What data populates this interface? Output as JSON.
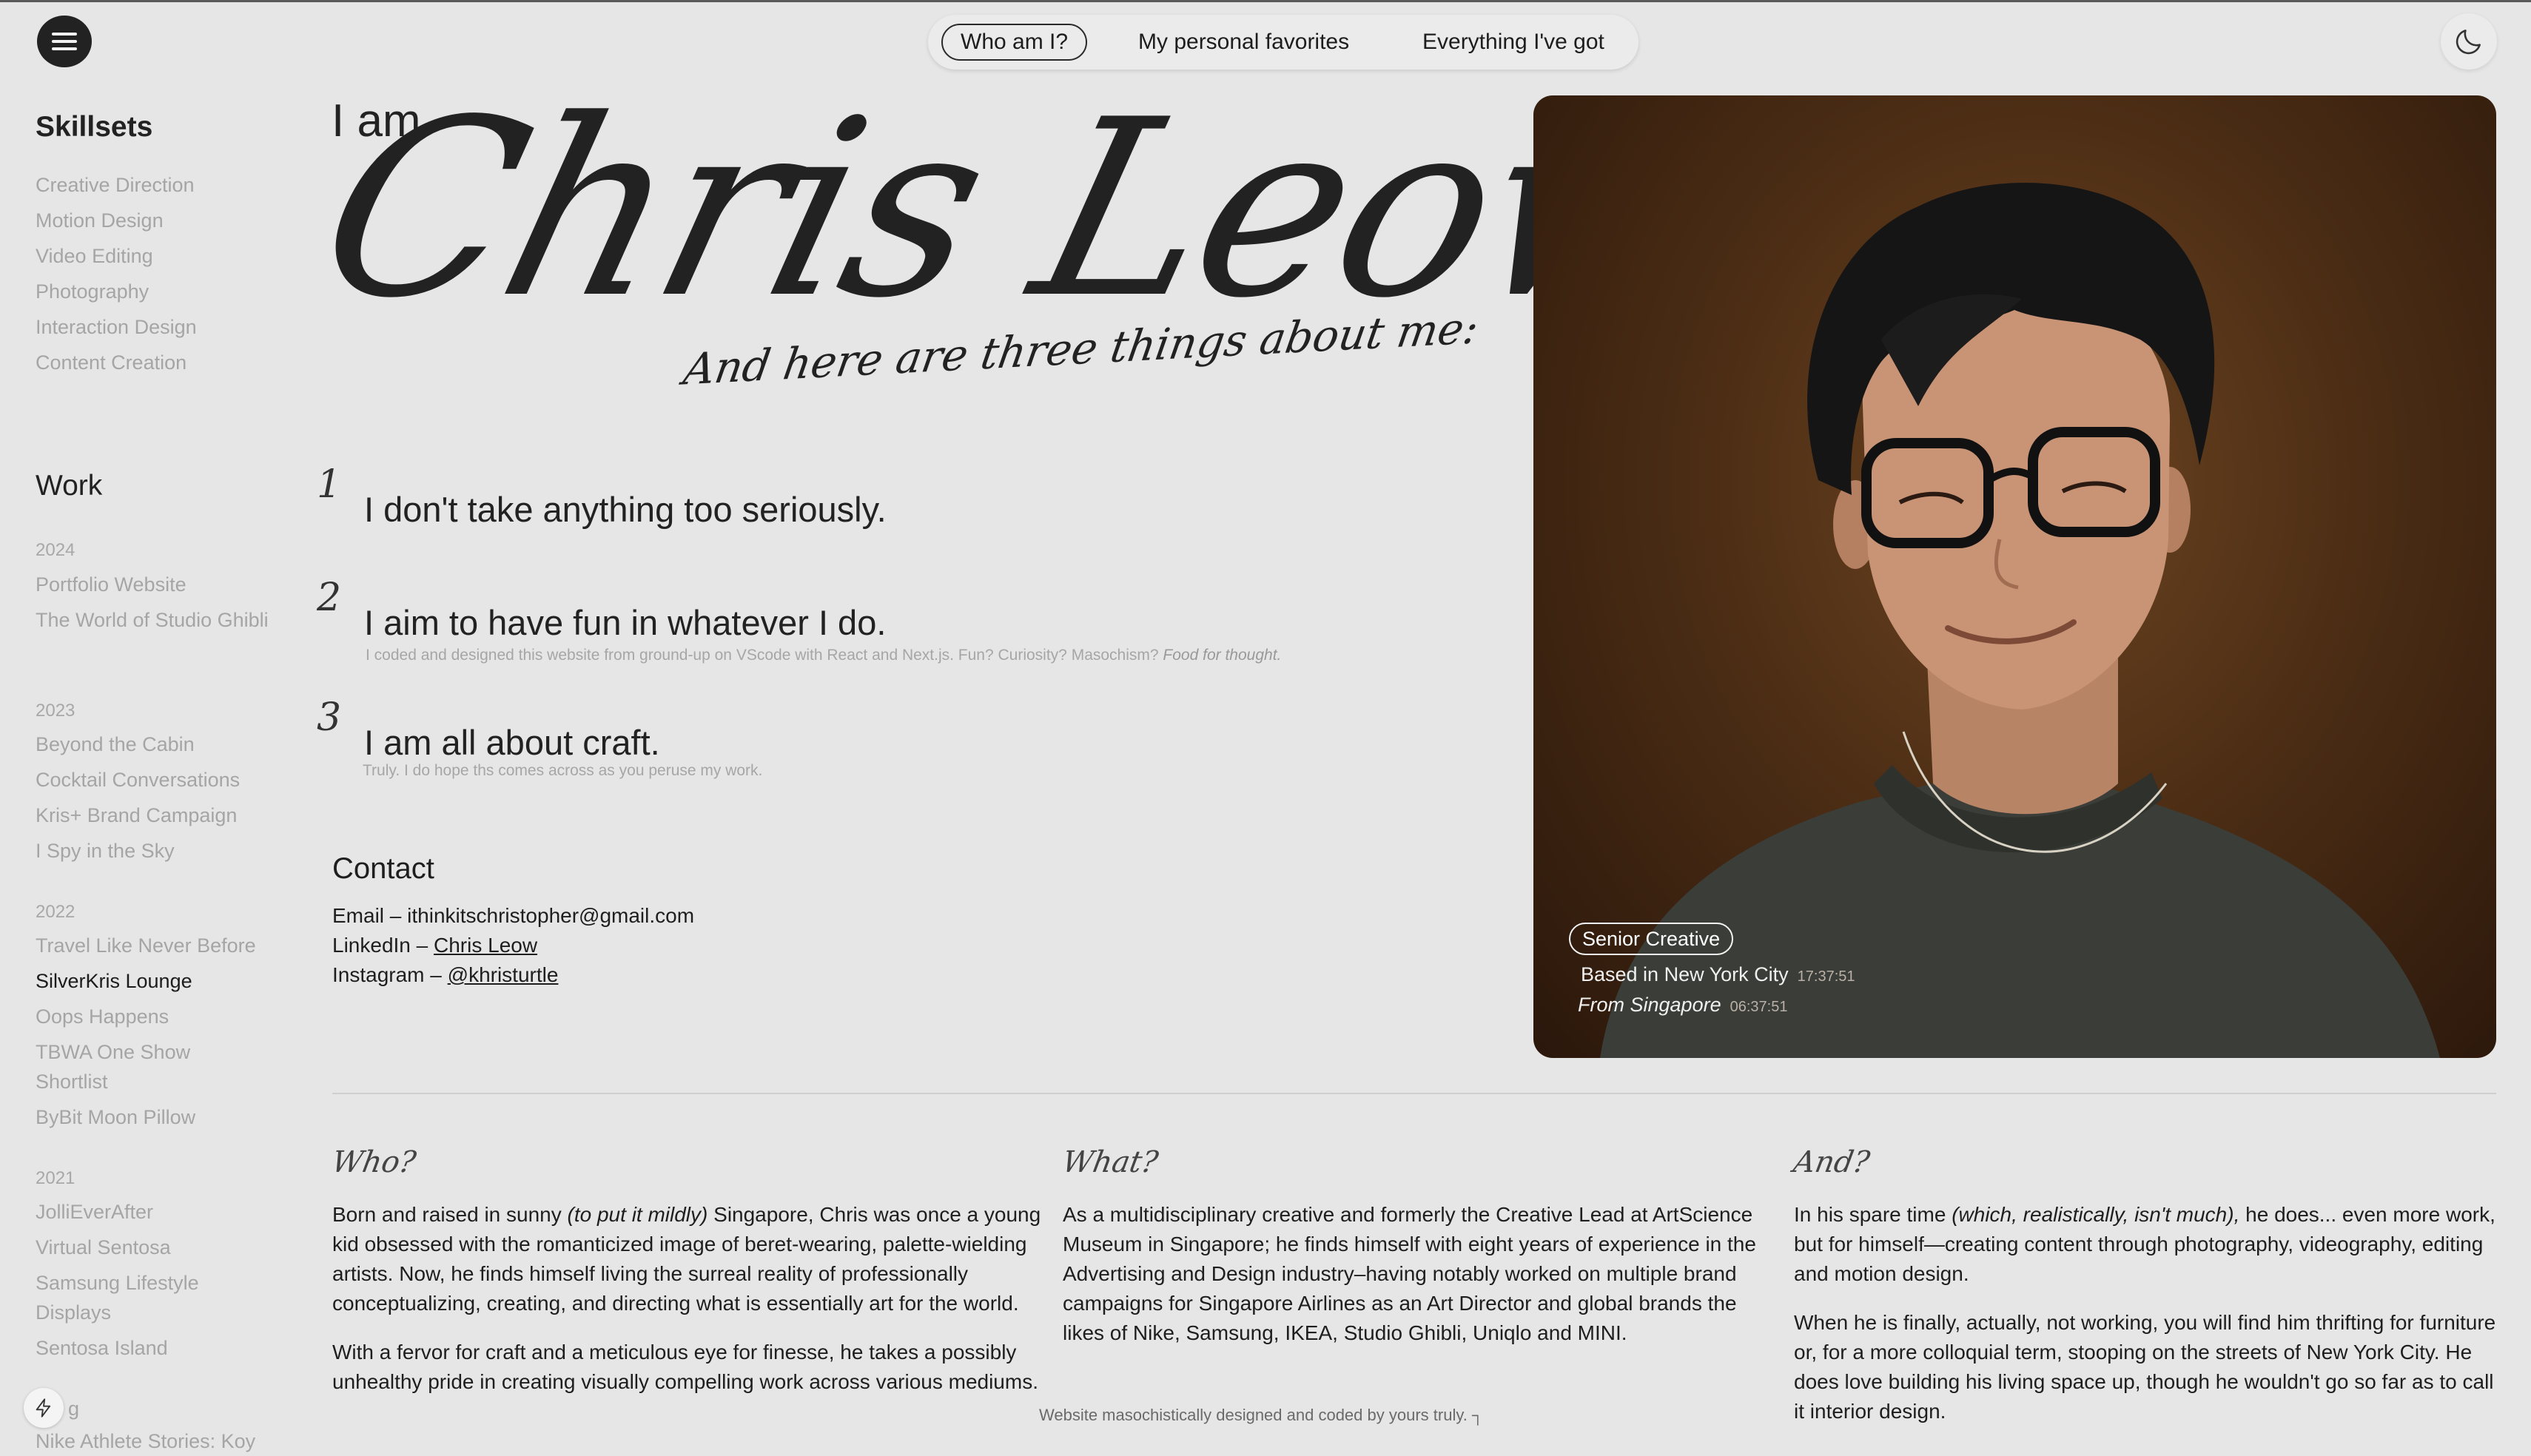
{
  "nav": {
    "tabs": [
      {
        "label": "Who am I?",
        "active": true
      },
      {
        "label": "My personal favorites",
        "active": false
      },
      {
        "label": "Everything I've got",
        "active": false
      }
    ]
  },
  "sidebar": {
    "skillsets_title": "Skillsets",
    "skills": [
      "Creative Direction",
      "Motion Design",
      "Video Editing",
      "Photography",
      "Interaction Design",
      "Content Creation"
    ],
    "work_title": "Work",
    "years": [
      "2024",
      "2023",
      "2022",
      "2021"
    ],
    "work_items": [
      "Portfolio Website",
      "The World of Studio Ghibli",
      "Beyond the Cabin",
      "Cocktail Conversations",
      "Kris+ Brand Campaign",
      "I Spy in the Sky",
      "Travel Like Never Before",
      "SilverKris Lounge",
      "Oops Happens",
      "TBWA One Show Shortlist",
      "ByBit Moon Pillow",
      "JolliEverAfter",
      "Virtual Sentosa",
      "Samsung Lifestyle Displays",
      "Sentosa Island",
      "Nike Athlete Stories: Koy"
    ],
    "partial_item": "g",
    "current_item": "SilverKris Lounge"
  },
  "hero": {
    "intro": "I am",
    "name": "Chris Leow",
    "subtitle": "And here are three things about me:"
  },
  "points": [
    {
      "number": "1",
      "text": "I don't take anything too seriously.",
      "note": "",
      "note_em": ""
    },
    {
      "number": "2",
      "text": "I aim to have fun in whatever I do.",
      "note": "I coded and designed this website from ground-up on VScode with React and Next.js. Fun? Curiosity? Masochism?",
      "note_em": "Food for thought."
    },
    {
      "number": "3",
      "text": "I am all about craft.",
      "note": "Truly. I do hope ths comes across as you peruse my work.",
      "note_em": ""
    }
  ],
  "contact": {
    "title": "Contact",
    "email_label": "Email –",
    "email": "ithinkitschristopher@gmail.com",
    "linkedin_label": "LinkedIn –",
    "linkedin": "Chris Leow",
    "instagram_label": "Instagram –",
    "instagram": "@khristurtle"
  },
  "photo": {
    "badge": "Senior Creative",
    "based": "Based in New York City",
    "based_time": "17:37:51",
    "from": "From Singapore",
    "from_time": "06:37:51"
  },
  "columns": {
    "who": {
      "heading": "Who?",
      "p1_a": "Born and raised in sunny",
      "p1_em": "(to put it mildly)",
      "p1_b": "Singapore, Chris was once a young kid obsessed with the romanticized image of beret-wearing, palette-wielding artists. Now, he finds himself living the surreal reality of professionally conceptualizing, creating, and directing what is essentially art for the world.",
      "p2": "With a fervor for craft and a meticulous eye for finesse, he takes a possibly unhealthy pride in creating visually compelling work across various mediums."
    },
    "what": {
      "heading": "What?",
      "p1": "As a multidisciplinary creative and formerly the Creative Lead at ArtScience Museum in Singapore; he finds himself with eight years of experience in the Advertising and Design industry–having notably worked on multiple brand campaigns for Singapore Airlines as an Art Director and global brands the likes of Nike, Samsung, IKEA, Studio Ghibli, Uniqlo and MINI."
    },
    "and": {
      "heading": "And?",
      "p1_a": "In his spare time",
      "p1_em": "(which, realistically, isn't much),",
      "p1_b": "he does... even more work, but for himself—creating content through photography, videography, editing and motion design.",
      "p2": "When he is finally, actually, not working, you will find him thrifting for furniture or, for a more colloquial term, stooping on the streets of New York City. He does love building his living space up, though he wouldn't go so far as to call it interior design."
    }
  },
  "footer": {
    "text": "Website masochistically designed and coded by yours truly."
  },
  "icons": {
    "menu": "hamburger-menu-icon",
    "theme": "moon-icon",
    "bolt": "lightning-bolt-icon"
  },
  "colors": {
    "background": "#e6e6e6",
    "text": "#1c1c1c",
    "muted": "#a5a5a5"
  }
}
